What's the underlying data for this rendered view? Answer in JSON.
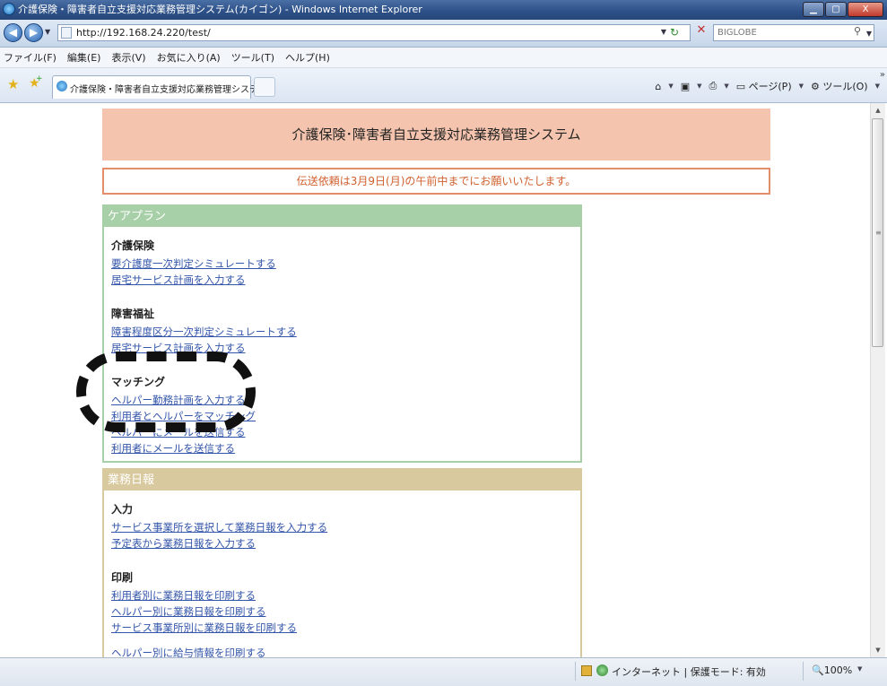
{
  "window": {
    "title": "介護保険・障害者自立支援対応業務管理システム(カイゴン) - Windows Internet Explorer",
    "min_label": "▁",
    "max_label": "▢",
    "close_label": "X"
  },
  "address": {
    "url": "http://192.168.24.220/test/",
    "search_placeholder": "BIGLOBE"
  },
  "menu": [
    "ファイル(F)",
    "編集(E)",
    "表示(V)",
    "お気に入り(A)",
    "ツール(T)",
    "ヘルプ(H)"
  ],
  "tab": {
    "title": "介護保険・障害者自立支援対応業務管理システ..."
  },
  "commands": {
    "page": "ページ(P)",
    "tools": "ツール(O)"
  },
  "page": {
    "header": "介護保険･障害者自立支援対応業務管理システム",
    "notice": "伝送依頼は3月9日(月)の午前中までにお願いいたします。",
    "careplan": {
      "title": "ケアプラン",
      "groups": [
        {
          "title": "介護保険",
          "links": [
            "要介護度一次判定シミュレートする",
            "居宅サービス計画を入力する"
          ]
        },
        {
          "title": "障害福祉",
          "links": [
            "障害程度区分一次判定シミュレートする",
            "居宅サービス計画を入力する"
          ]
        },
        {
          "title": "マッチング",
          "links": [
            "ヘルパー勤務計画を入力する",
            "利用者とヘルパーをマッチング",
            "ヘルパーにメールを送信する",
            "利用者にメールを送信する"
          ]
        }
      ]
    },
    "gyomu": {
      "title": "業務日報",
      "groups": [
        {
          "title": "入力",
          "links": [
            "サービス事業所を選択して業務日報を入力する",
            "予定表から業務日報を入力する"
          ]
        },
        {
          "title": "印刷",
          "links": [
            "利用者別に業務日報を印刷する",
            "ヘルパー別に業務日報を印刷する",
            "サービス事業所別に業務日報を印刷する",
            "ヘルパー別に給与情報を印刷する"
          ]
        }
      ]
    }
  },
  "status": {
    "zone": "インターネット | 保護モード: 有効",
    "zoom": "100%"
  },
  "colors": {
    "header_bg": "#f5c4ae",
    "notice_border": "#e38d6a",
    "notice_text": "#d0602e",
    "careplan_accent": "#a8d0a8",
    "gyomu_accent": "#d9c99e",
    "link": "#3355aa"
  }
}
